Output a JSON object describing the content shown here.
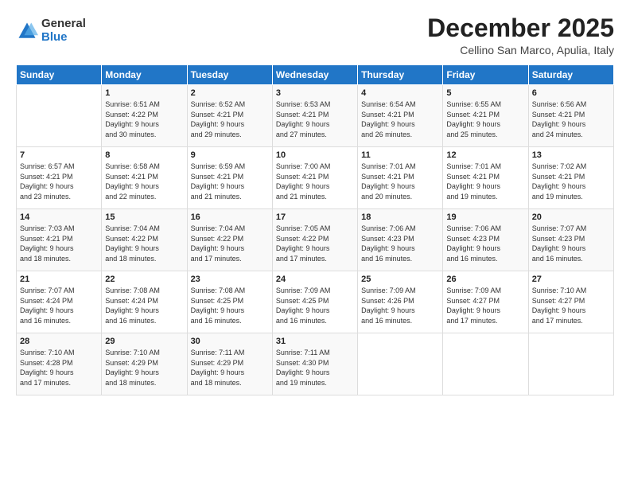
{
  "logo": {
    "general": "General",
    "blue": "Blue"
  },
  "title": "December 2025",
  "subtitle": "Cellino San Marco, Apulia, Italy",
  "header": {
    "days": [
      "Sunday",
      "Monday",
      "Tuesday",
      "Wednesday",
      "Thursday",
      "Friday",
      "Saturday"
    ]
  },
  "weeks": [
    [
      {
        "day": "",
        "info": ""
      },
      {
        "day": "1",
        "info": "Sunrise: 6:51 AM\nSunset: 4:22 PM\nDaylight: 9 hours\nand 30 minutes."
      },
      {
        "day": "2",
        "info": "Sunrise: 6:52 AM\nSunset: 4:21 PM\nDaylight: 9 hours\nand 29 minutes."
      },
      {
        "day": "3",
        "info": "Sunrise: 6:53 AM\nSunset: 4:21 PM\nDaylight: 9 hours\nand 27 minutes."
      },
      {
        "day": "4",
        "info": "Sunrise: 6:54 AM\nSunset: 4:21 PM\nDaylight: 9 hours\nand 26 minutes."
      },
      {
        "day": "5",
        "info": "Sunrise: 6:55 AM\nSunset: 4:21 PM\nDaylight: 9 hours\nand 25 minutes."
      },
      {
        "day": "6",
        "info": "Sunrise: 6:56 AM\nSunset: 4:21 PM\nDaylight: 9 hours\nand 24 minutes."
      }
    ],
    [
      {
        "day": "7",
        "info": "Sunrise: 6:57 AM\nSunset: 4:21 PM\nDaylight: 9 hours\nand 23 minutes."
      },
      {
        "day": "8",
        "info": "Sunrise: 6:58 AM\nSunset: 4:21 PM\nDaylight: 9 hours\nand 22 minutes."
      },
      {
        "day": "9",
        "info": "Sunrise: 6:59 AM\nSunset: 4:21 PM\nDaylight: 9 hours\nand 21 minutes."
      },
      {
        "day": "10",
        "info": "Sunrise: 7:00 AM\nSunset: 4:21 PM\nDaylight: 9 hours\nand 21 minutes."
      },
      {
        "day": "11",
        "info": "Sunrise: 7:01 AM\nSunset: 4:21 PM\nDaylight: 9 hours\nand 20 minutes."
      },
      {
        "day": "12",
        "info": "Sunrise: 7:01 AM\nSunset: 4:21 PM\nDaylight: 9 hours\nand 19 minutes."
      },
      {
        "day": "13",
        "info": "Sunrise: 7:02 AM\nSunset: 4:21 PM\nDaylight: 9 hours\nand 19 minutes."
      }
    ],
    [
      {
        "day": "14",
        "info": "Sunrise: 7:03 AM\nSunset: 4:21 PM\nDaylight: 9 hours\nand 18 minutes."
      },
      {
        "day": "15",
        "info": "Sunrise: 7:04 AM\nSunset: 4:22 PM\nDaylight: 9 hours\nand 18 minutes."
      },
      {
        "day": "16",
        "info": "Sunrise: 7:04 AM\nSunset: 4:22 PM\nDaylight: 9 hours\nand 17 minutes."
      },
      {
        "day": "17",
        "info": "Sunrise: 7:05 AM\nSunset: 4:22 PM\nDaylight: 9 hours\nand 17 minutes."
      },
      {
        "day": "18",
        "info": "Sunrise: 7:06 AM\nSunset: 4:23 PM\nDaylight: 9 hours\nand 16 minutes."
      },
      {
        "day": "19",
        "info": "Sunrise: 7:06 AM\nSunset: 4:23 PM\nDaylight: 9 hours\nand 16 minutes."
      },
      {
        "day": "20",
        "info": "Sunrise: 7:07 AM\nSunset: 4:23 PM\nDaylight: 9 hours\nand 16 minutes."
      }
    ],
    [
      {
        "day": "21",
        "info": "Sunrise: 7:07 AM\nSunset: 4:24 PM\nDaylight: 9 hours\nand 16 minutes."
      },
      {
        "day": "22",
        "info": "Sunrise: 7:08 AM\nSunset: 4:24 PM\nDaylight: 9 hours\nand 16 minutes."
      },
      {
        "day": "23",
        "info": "Sunrise: 7:08 AM\nSunset: 4:25 PM\nDaylight: 9 hours\nand 16 minutes."
      },
      {
        "day": "24",
        "info": "Sunrise: 7:09 AM\nSunset: 4:25 PM\nDaylight: 9 hours\nand 16 minutes."
      },
      {
        "day": "25",
        "info": "Sunrise: 7:09 AM\nSunset: 4:26 PM\nDaylight: 9 hours\nand 16 minutes."
      },
      {
        "day": "26",
        "info": "Sunrise: 7:09 AM\nSunset: 4:27 PM\nDaylight: 9 hours\nand 17 minutes."
      },
      {
        "day": "27",
        "info": "Sunrise: 7:10 AM\nSunset: 4:27 PM\nDaylight: 9 hours\nand 17 minutes."
      }
    ],
    [
      {
        "day": "28",
        "info": "Sunrise: 7:10 AM\nSunset: 4:28 PM\nDaylight: 9 hours\nand 17 minutes."
      },
      {
        "day": "29",
        "info": "Sunrise: 7:10 AM\nSunset: 4:29 PM\nDaylight: 9 hours\nand 18 minutes."
      },
      {
        "day": "30",
        "info": "Sunrise: 7:11 AM\nSunset: 4:29 PM\nDaylight: 9 hours\nand 18 minutes."
      },
      {
        "day": "31",
        "info": "Sunrise: 7:11 AM\nSunset: 4:30 PM\nDaylight: 9 hours\nand 19 minutes."
      },
      {
        "day": "",
        "info": ""
      },
      {
        "day": "",
        "info": ""
      },
      {
        "day": "",
        "info": ""
      }
    ]
  ]
}
